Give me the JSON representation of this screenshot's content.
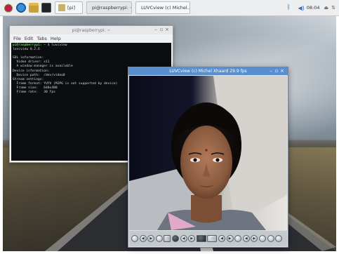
{
  "taskbar": {
    "tasks": [
      {
        "label": "[pi]"
      },
      {
        "label": "pi@raspberrypi: ~"
      },
      {
        "label": "LUVCview (c) Michel..."
      }
    ],
    "clock": "08:04",
    "icons": [
      "raspberry-menu-icon",
      "web-browser-icon",
      "file-manager-icon",
      "terminal-icon",
      "bluetooth-icon",
      "volume-icon",
      "eject-icon",
      "wifi-icon"
    ]
  },
  "terminal": {
    "title": "pi@raspberrypi: ~",
    "menu": [
      "File",
      "Edit",
      "Tabs",
      "Help"
    ],
    "prompt_user": "pi@raspberrypi:",
    "prompt_path": "~ $",
    "command": " luvcview",
    "output": [
      "luvcview 0.2.6",
      "",
      "SDL information:",
      "  Video driver: x11",
      "  A window manager is available",
      "Device information:",
      "  Device path:  /dev/video0",
      "Stream settings:",
      "  Frame format: YUYV (MJPG is not supported by device)",
      "  Frame size:   640x480",
      "  Frame rate:   30 fps"
    ]
  },
  "camera": {
    "title": "LUVCview (c) Michel Xhaard  29.9 fps",
    "toolbar_buttons": 26
  },
  "colors": {
    "titlebar_active": "#5a8fcf",
    "terminal_bg": "#0b0d0f",
    "prompt_user": "#5fd35f",
    "prompt_path": "#6aa6ff"
  }
}
